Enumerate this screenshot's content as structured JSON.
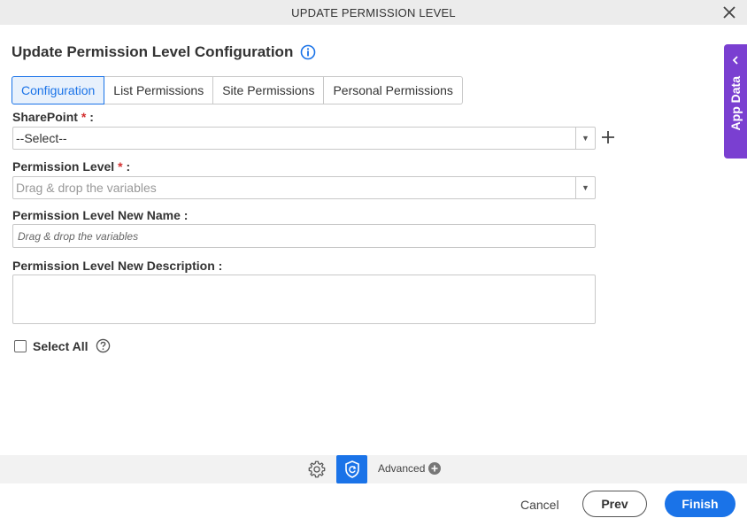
{
  "dialog": {
    "title": "UPDATE PERMISSION LEVEL",
    "close_icon": "close-icon"
  },
  "heading": {
    "text": "Update Permission Level Configuration",
    "info_icon": "info-icon"
  },
  "tabs": [
    {
      "label": "Configuration",
      "active": true
    },
    {
      "label": "List Permissions",
      "active": false
    },
    {
      "label": "Site Permissions",
      "active": false
    },
    {
      "label": "Personal Permissions",
      "active": false
    }
  ],
  "form": {
    "sharepoint": {
      "label": "SharePoint",
      "required_mark": "*",
      "colon": ":",
      "value": "--Select--"
    },
    "permission_level": {
      "label": "Permission Level",
      "required_mark": "*",
      "colon": ":",
      "placeholder": "Drag & drop the variables"
    },
    "new_name": {
      "label": "Permission Level New Name :",
      "placeholder": "Drag & drop the variables"
    },
    "new_description": {
      "label": "Permission Level New Description :",
      "value": ""
    },
    "select_all": {
      "label": "Select All",
      "checked": false
    }
  },
  "side_panel": {
    "label": "App Data"
  },
  "footer": {
    "advanced_label": "Advanced",
    "cancel_label": "Cancel",
    "prev_label": "Prev",
    "finish_label": "Finish"
  },
  "colors": {
    "accent": "#1a73e8",
    "app_data_panel": "#7a3fd1",
    "required": "#d32f2f"
  }
}
